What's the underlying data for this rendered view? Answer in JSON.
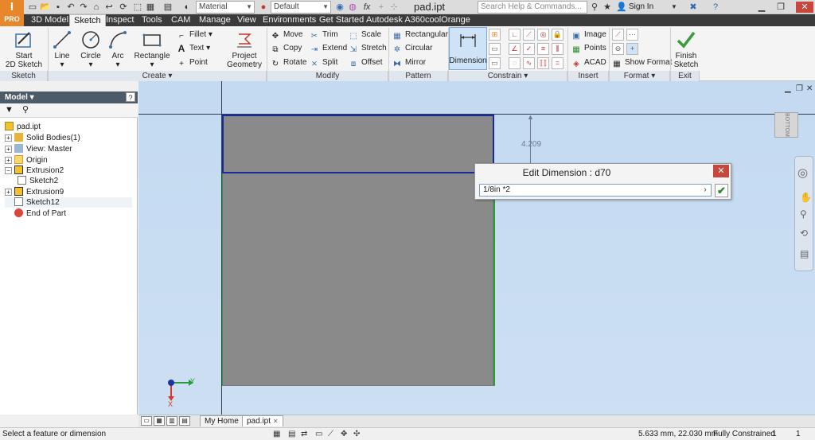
{
  "app": {
    "badge": "PRO",
    "doc_title": "pad.ipt"
  },
  "toolbar": {
    "material": "Material",
    "appearance": "Default",
    "fx": "fx",
    "help_placeholder": "Search Help & Commands...",
    "sign_in": "Sign In"
  },
  "menu_tabs": [
    "3D Model",
    "Sketch",
    "Inspect",
    "Tools",
    "CAM",
    "Manage",
    "View",
    "Environments",
    "Get Started",
    "Autodesk A360",
    "coolOrange"
  ],
  "ribbon": {
    "sketch": {
      "start_label": "Start",
      "start_label2": "2D Sketch",
      "panel": "Sketch"
    },
    "create": {
      "line": "Line",
      "circle": "Circle",
      "arc": "Arc",
      "rectangle": "Rectangle",
      "fillet": "Fillet",
      "text": "Text",
      "point": "Point",
      "project1": "Project",
      "project2": "Geometry",
      "panel": "Create"
    },
    "modify": {
      "move": "Move",
      "trim": "Trim",
      "scale": "Scale",
      "copy": "Copy",
      "extend": "Extend",
      "stretch": "Stretch",
      "rotate": "Rotate",
      "split": "Split",
      "offset": "Offset",
      "panel": "Modify"
    },
    "pattern": {
      "rectangular": "Rectangular",
      "circular": "Circular",
      "mirror": "Mirror",
      "panel": "Pattern"
    },
    "constrain": {
      "dimension": "Dimension",
      "panel": "Constrain"
    },
    "insert": {
      "image": "Image",
      "points": "Points",
      "acad": "ACAD",
      "panel": "Insert"
    },
    "format": {
      "show_format": "Show Format",
      "panel": "Format"
    },
    "exit": {
      "finish1": "Finish",
      "finish2": "Sketch",
      "panel": "Exit"
    }
  },
  "browser": {
    "title": "Model",
    "items": [
      {
        "label": "pad.ipt",
        "depth": 0
      },
      {
        "label": "Solid Bodies(1)",
        "depth": 1
      },
      {
        "label": "View: Master",
        "depth": 1
      },
      {
        "label": "Origin",
        "depth": 1
      },
      {
        "label": "Extrusion2",
        "depth": 1
      },
      {
        "label": "Sketch2",
        "depth": 2
      },
      {
        "label": "Extrusion9",
        "depth": 1
      },
      {
        "label": "Sketch12",
        "depth": 1
      },
      {
        "label": "End of Part",
        "depth": 1
      }
    ]
  },
  "canvas": {
    "dimension_value": "4.209",
    "view_cube_label": "BOTTOM",
    "axis_x": "X",
    "axis_y": "Y"
  },
  "dialog": {
    "title": "Edit Dimension : d70",
    "value": "1/8in *2"
  },
  "doc_tabs": [
    "My Home",
    "pad.ipt"
  ],
  "status": {
    "message": "Select a feature or dimension",
    "coords": "5.633 mm, 22.030 mm",
    "state": "Fully Constrained",
    "count": "1"
  }
}
